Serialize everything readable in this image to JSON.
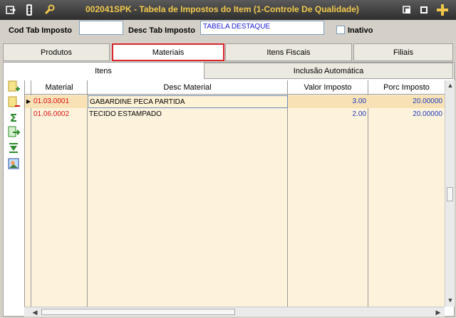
{
  "window": {
    "title": "002041SPK - Tabela de Impostos do Item (1-Controle De Qualidade)",
    "title_color": "#f2c94c"
  },
  "form": {
    "cod_label": "Cod Tab Imposto",
    "cod_value": "",
    "desc_label": "Desc Tab Imposto",
    "desc_value": "TABELA DESTAQUE",
    "inativo_label": "Inativo",
    "inativo_checked": false
  },
  "tabs": [
    {
      "label": "Produtos",
      "active": false
    },
    {
      "label": "Materiais",
      "active": true
    },
    {
      "label": "Itens Fiscais",
      "active": false
    },
    {
      "label": "Filiais",
      "active": false
    }
  ],
  "subtabs": [
    {
      "label": "Itens",
      "active": true
    },
    {
      "label": "Inclusão Automática",
      "active": false
    }
  ],
  "toolbar": [
    "add-row-icon",
    "delete-row-icon",
    "sum-icon",
    "export-icon",
    "download-icon",
    "image-icon"
  ],
  "grid": {
    "columns": [
      "Material",
      "Desc Material",
      "Valor Imposto",
      "Porc Imposto"
    ],
    "rows": [
      {
        "material": "01.03.0001",
        "desc": "GABARDINE PECA PARTIDA",
        "valor": "3.00",
        "porc": "20.00000",
        "selected": true
      },
      {
        "material": "01.06.0002",
        "desc": "TECIDO ESTAMPADO",
        "valor": "2.00",
        "porc": "20.00000",
        "selected": false
      }
    ]
  },
  "colors": {
    "accent_red": "#d9262c",
    "grid_bg": "#fdf3dc",
    "selected_row": "#f7e1b5"
  }
}
